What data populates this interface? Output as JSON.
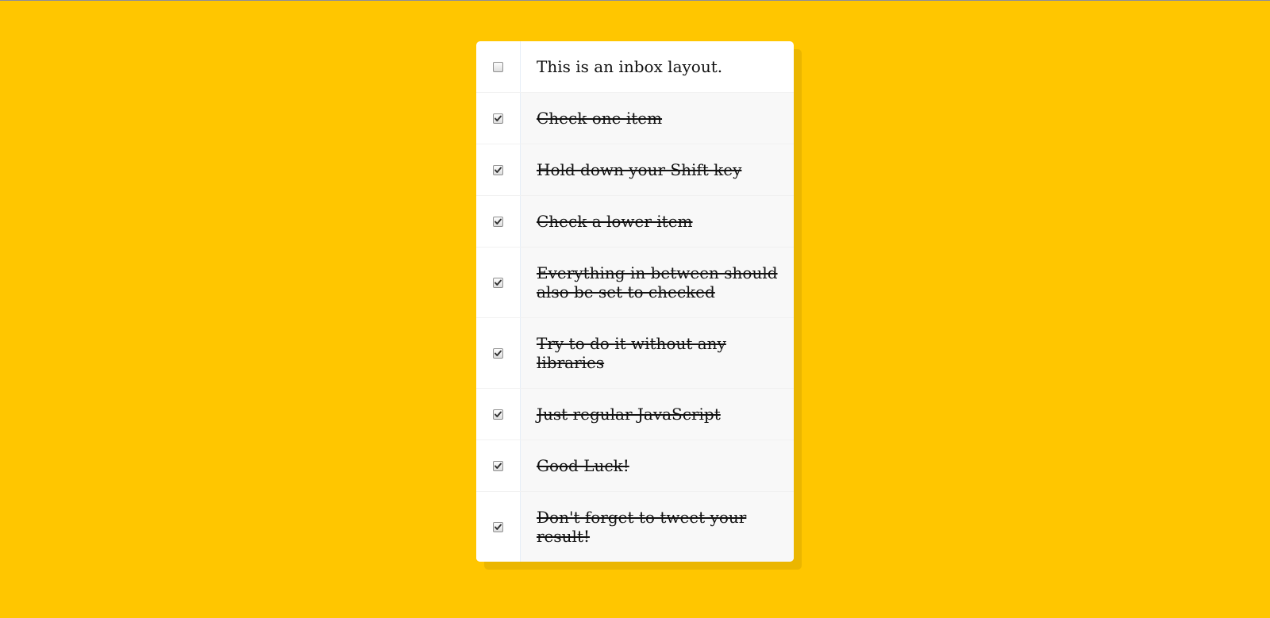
{
  "items": [
    {
      "label": "This is an inbox layout.",
      "checked": false
    },
    {
      "label": "Check one item",
      "checked": true
    },
    {
      "label": "Hold down your Shift key",
      "checked": true
    },
    {
      "label": "Check a lower item",
      "checked": true
    },
    {
      "label": "Everything in between should also be set to checked",
      "checked": true
    },
    {
      "label": "Try to do it without any libraries",
      "checked": true
    },
    {
      "label": "Just regular JavaScript",
      "checked": true
    },
    {
      "label": "Good Luck!",
      "checked": true
    },
    {
      "label": "Don't forget to tweet your result!",
      "checked": true
    }
  ],
  "colors": {
    "background": "#ffc600",
    "card": "#ffffff",
    "checked_row": "#f8f8f8"
  }
}
